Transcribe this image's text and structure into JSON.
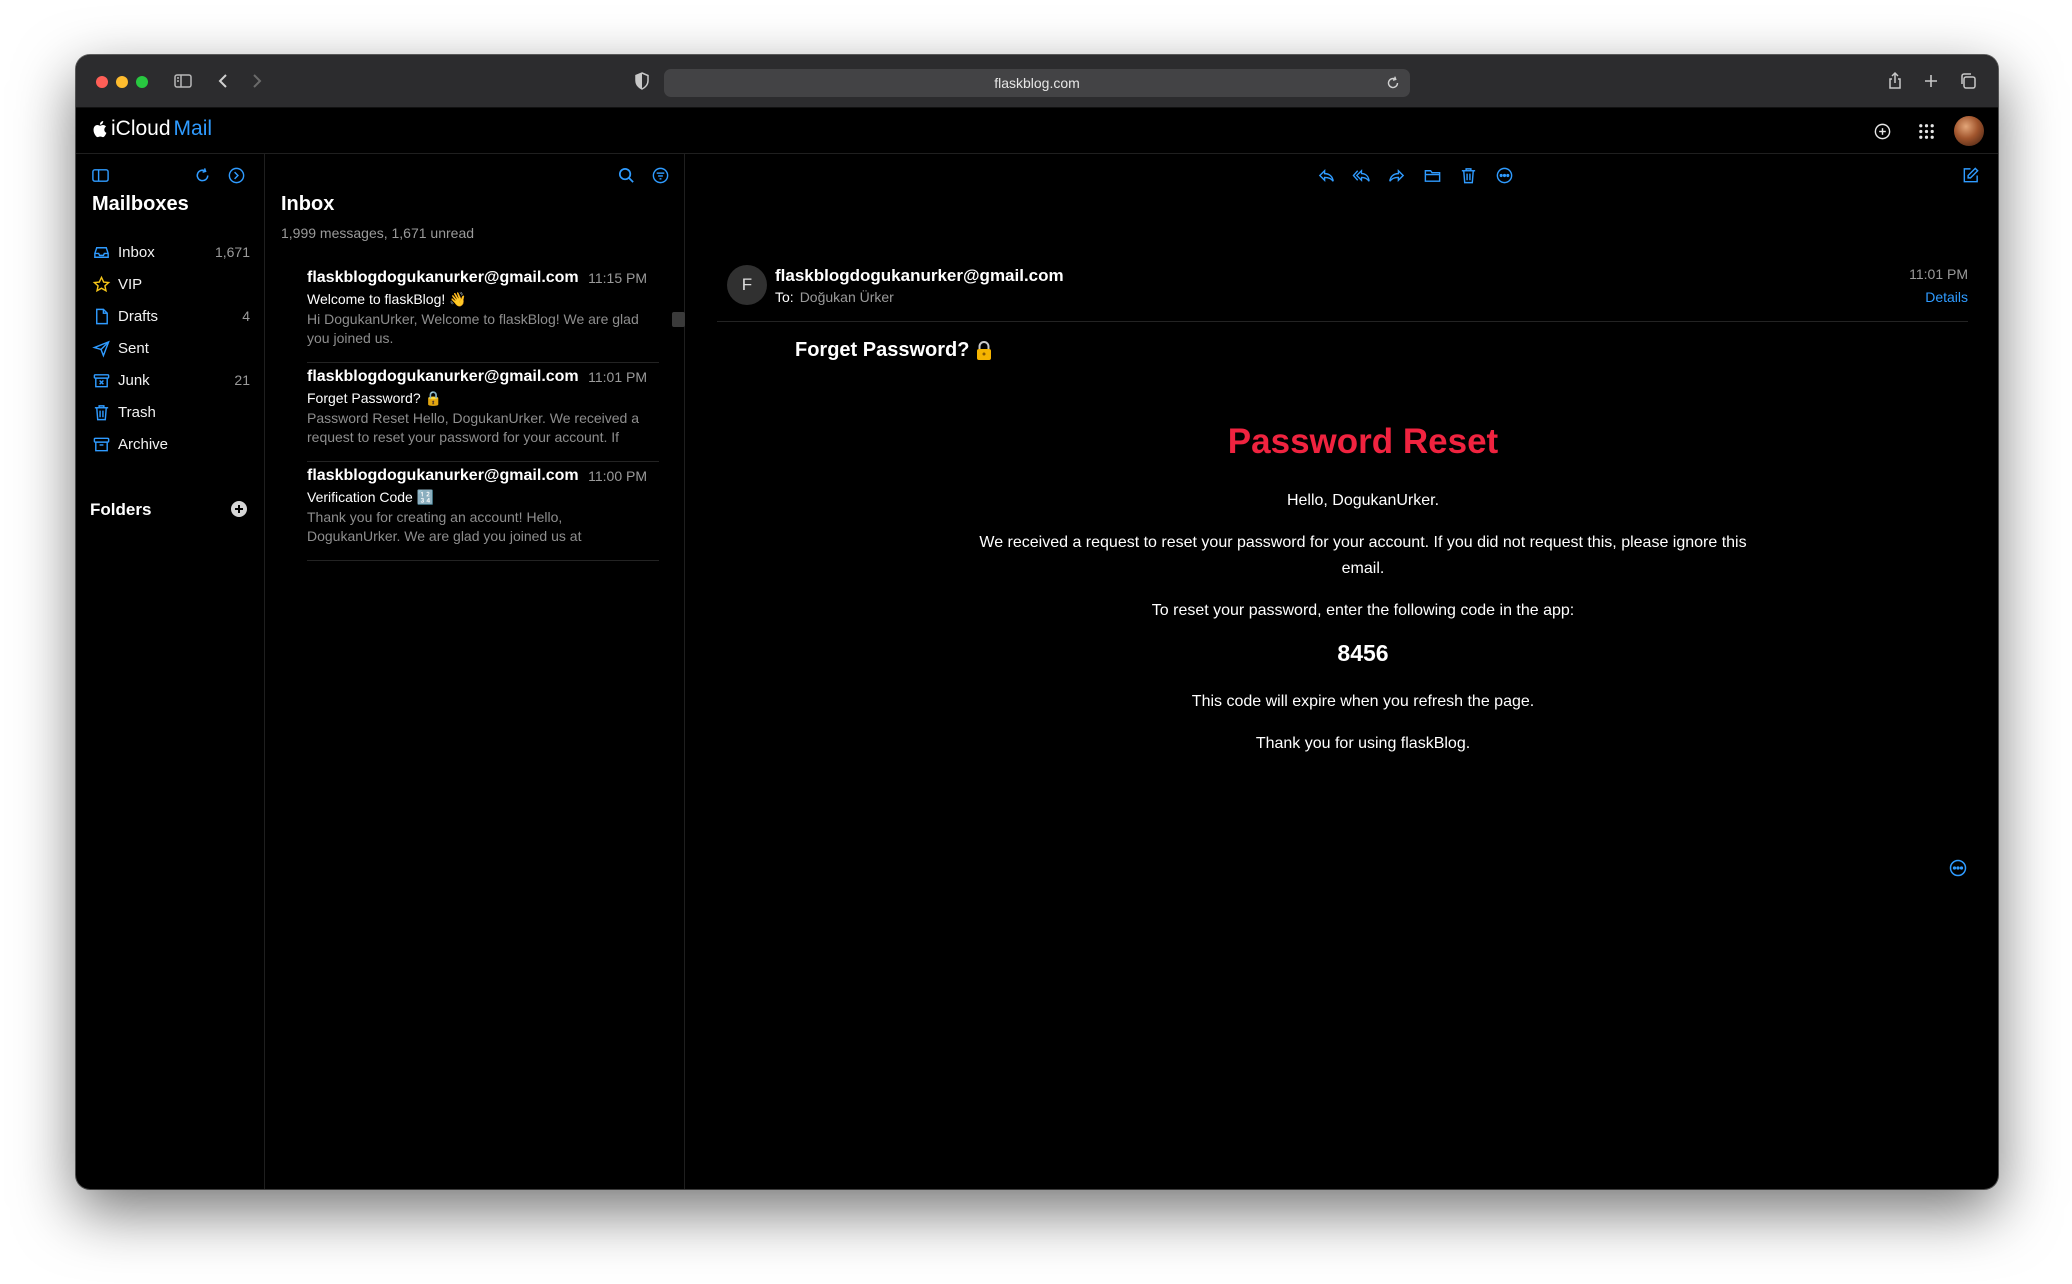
{
  "browser": {
    "url": "flaskblog.com"
  },
  "app": {
    "brand_icloud": "iCloud",
    "brand_mail": "Mail"
  },
  "mailboxes": {
    "title": "Mailboxes",
    "items": [
      {
        "label": "Inbox",
        "count": "1,671",
        "icon": "inbox-icon"
      },
      {
        "label": "VIP",
        "count": "",
        "icon": "star-icon"
      },
      {
        "label": "Drafts",
        "count": "4",
        "icon": "draft-icon"
      },
      {
        "label": "Sent",
        "count": "",
        "icon": "sent-icon"
      },
      {
        "label": "Junk",
        "count": "21",
        "icon": "junk-icon"
      },
      {
        "label": "Trash",
        "count": "",
        "icon": "trash-icon"
      },
      {
        "label": "Archive",
        "count": "",
        "icon": "archive-icon"
      }
    ],
    "folders_title": "Folders"
  },
  "message_list": {
    "title": "Inbox",
    "subtitle": "1,999 messages, 1,671 unread",
    "messages": [
      {
        "from": "flaskblogdogukanurker@gmail.com",
        "time": "11:15 PM",
        "subject": "Welcome to flaskBlog! 👋",
        "preview": "Hi DogukanUrker, Welcome to flaskBlog! We are glad you joined us."
      },
      {
        "from": "flaskblogdogukanurker@gmail.com",
        "time": "11:01 PM",
        "subject": "Forget Password? 🔒",
        "preview": "Password Reset Hello, DogukanUrker. We received a request to reset your password for your account. If"
      },
      {
        "from": "flaskblogdogukanurker@gmail.com",
        "time": "11:00 PM",
        "subject": "Verification Code 🔢",
        "preview": "Thank you for creating an account! Hello, DogukanUrker. We are glad you joined us at"
      }
    ]
  },
  "reader": {
    "sender_initial": "F",
    "from": "flaskblogdogukanurker@gmail.com",
    "to_label": "To:",
    "to_name": "Doğukan Ürker",
    "time": "11:01 PM",
    "details_label": "Details",
    "subject": "Forget Password?",
    "body": {
      "title": "Password Reset",
      "greeting": "Hello, DogukanUrker.",
      "para1": "We received a request to reset your password for your account. If you did not request this, please ignore this email.",
      "para2": "To reset your password, enter the following code in the app:",
      "code": "8456",
      "para3": "This code will expire when you refresh the page.",
      "para4": "Thank you for using flaskBlog."
    }
  },
  "colors": {
    "accent": "#2f9bff",
    "title_red": "#f0233f",
    "background": "#000000",
    "vip_star": "#f5c518"
  }
}
